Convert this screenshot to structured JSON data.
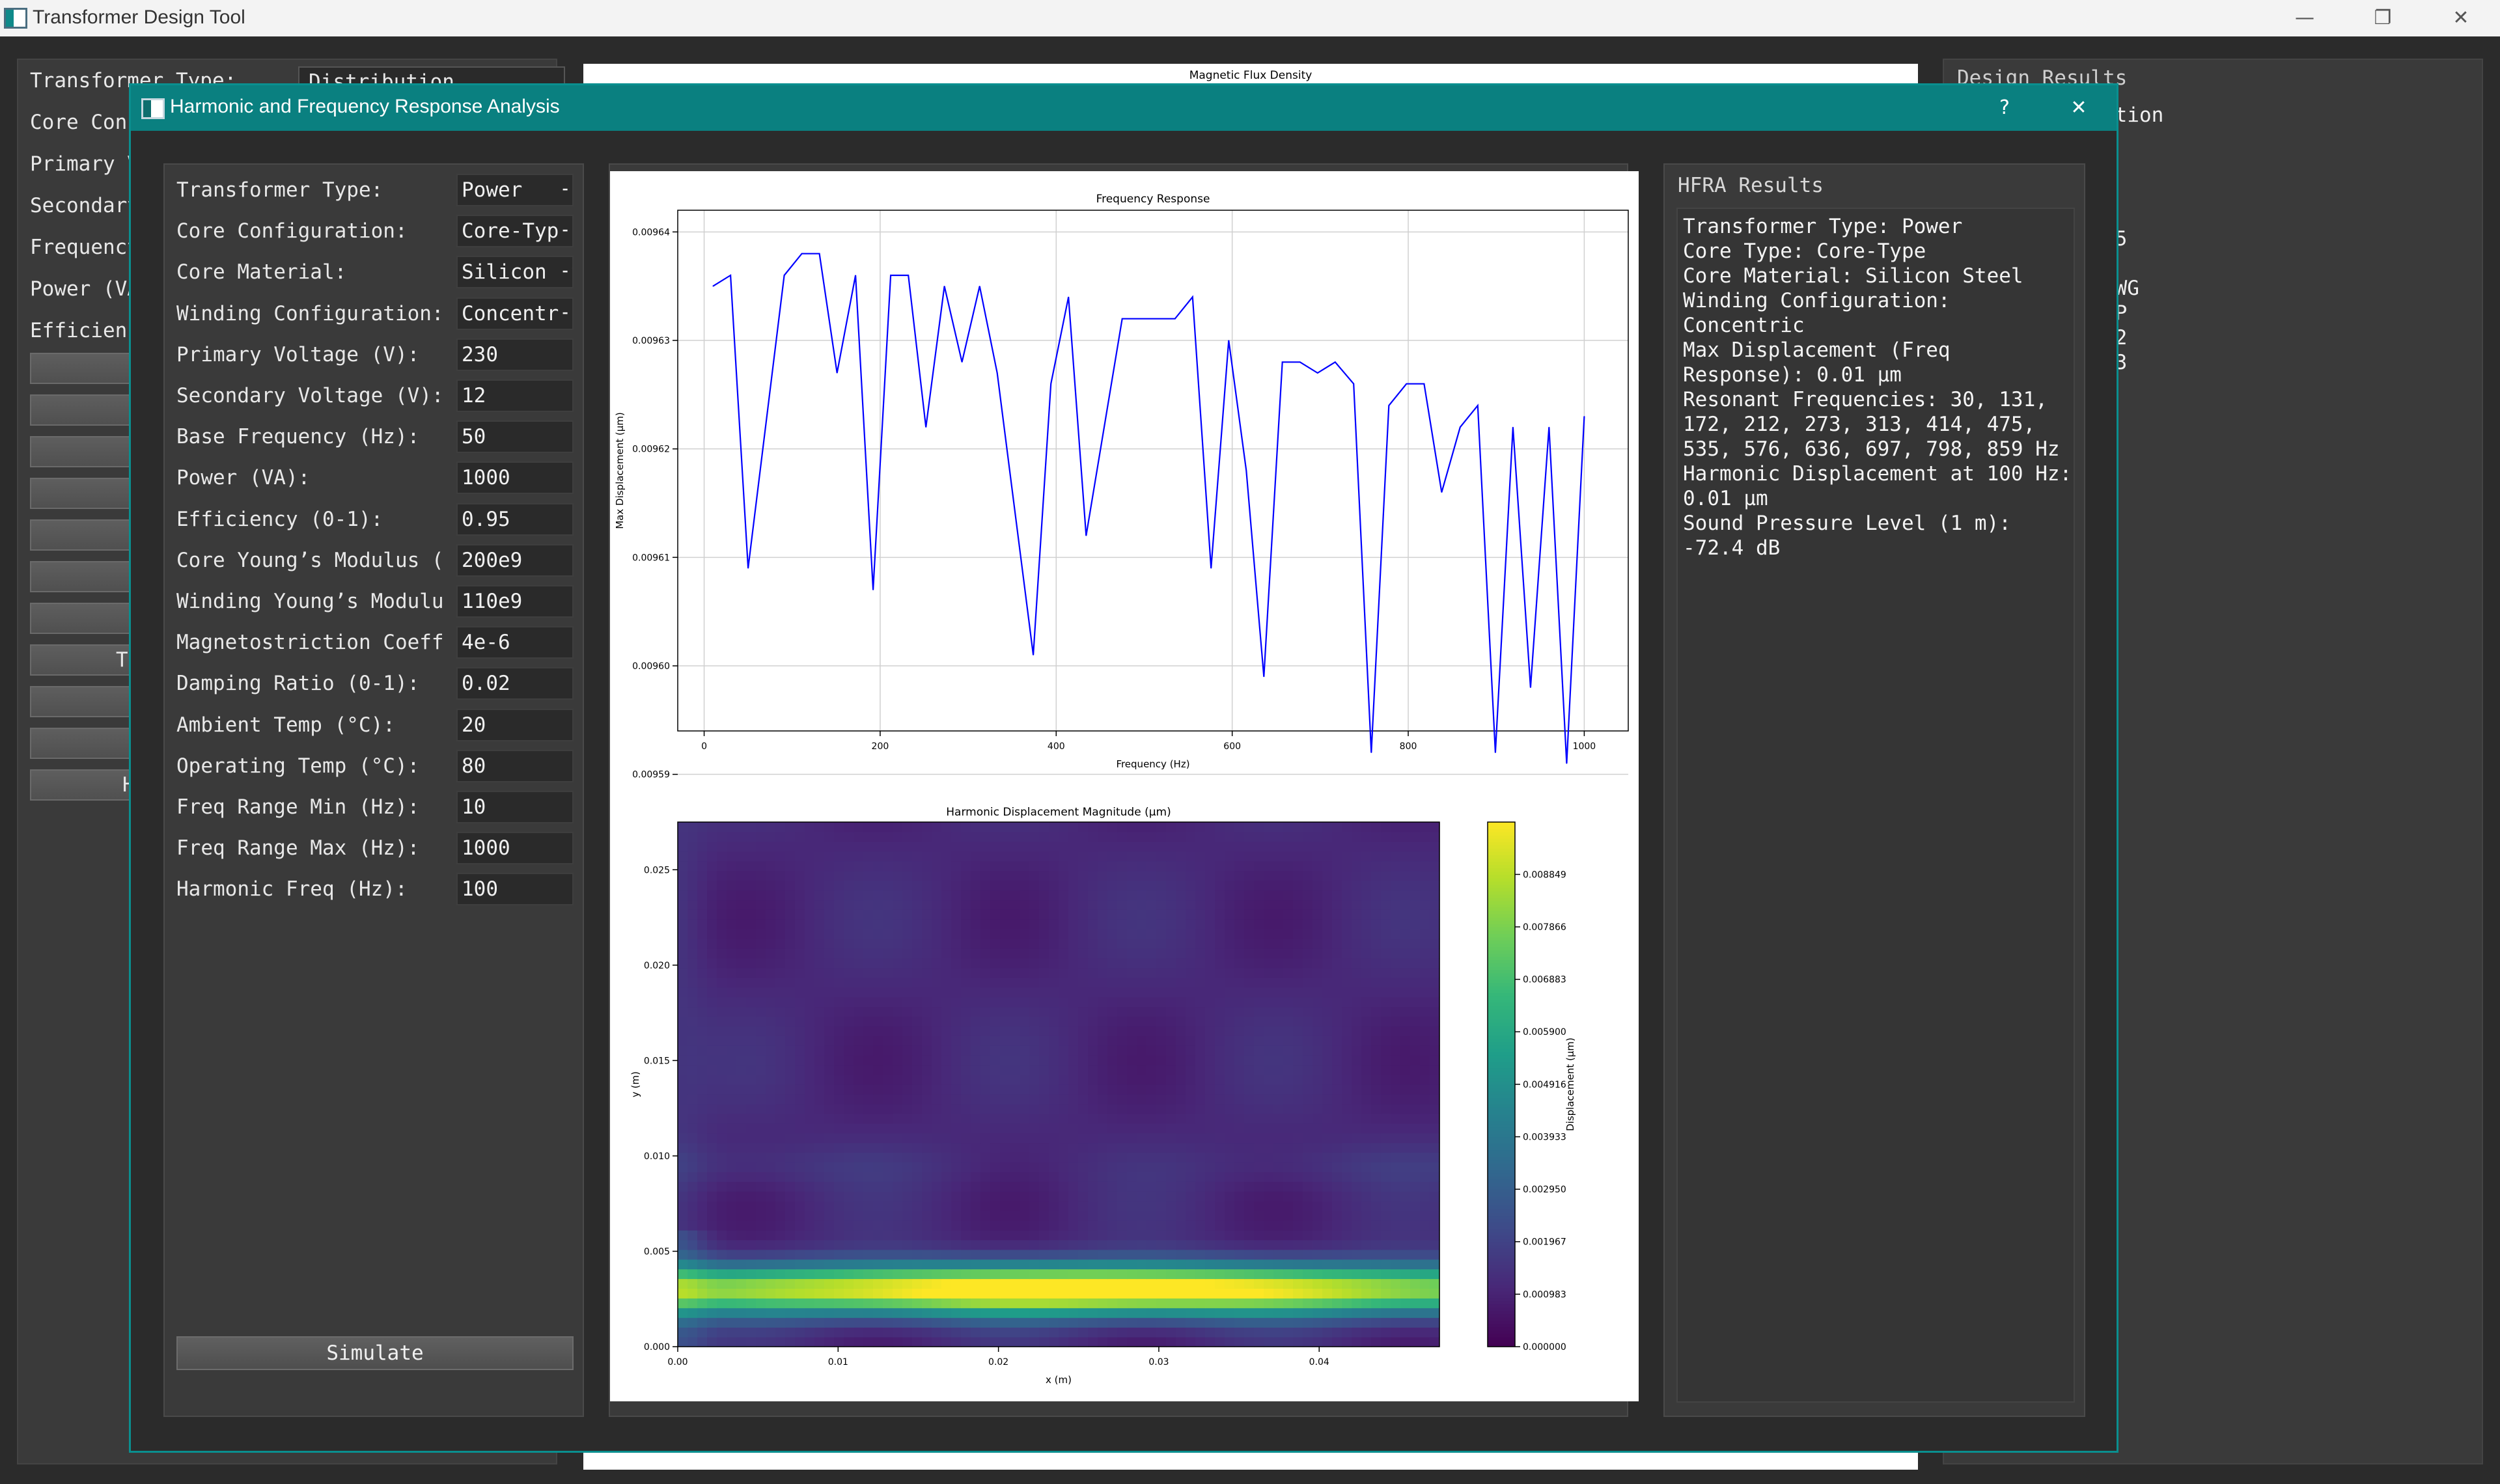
{
  "window": {
    "title": "Transformer Design Tool",
    "controls": {
      "minimize": "—",
      "maximize": "❐",
      "close": "✕"
    }
  },
  "background": {
    "left_labels": [
      "Transformer Type:",
      "Core Confi",
      "Primary V",
      "Secondary",
      "Frequency",
      "Power (VA",
      "Efficienc"
    ],
    "type_combo": "Distribution",
    "button_labels": [
      "",
      "",
      "",
      "",
      "",
      "",
      "",
      "Ter",
      "",
      "V",
      "Ha"
    ],
    "plot_title": "Magnetic Flux Density",
    "results_header": "Design Results",
    "results_text": "ype: Distribution\nell-Type\n0008 m²\n21.00\n 102774126730\nns: 4894006035\nGauge: 10 AWG\ne Gauge: 10 AWG\nPattern: P-S-P\ns: 17129021122\ners: 815667673\n)2 W\n5.00%\nsity: 1.26 T"
  },
  "dialog": {
    "title": "Harmonic and Frequency Response Analysis",
    "help_label": "?",
    "close_label": "✕",
    "form": [
      {
        "label": "Transformer Type:",
        "value": "Power",
        "kind": "combo"
      },
      {
        "label": "Core Configuration:",
        "value": "Core-Type",
        "kind": "combo"
      },
      {
        "label": "Core Material:",
        "value": "Silicon Steel",
        "kind": "combo"
      },
      {
        "label": "Winding Configuration:",
        "value": "Concentric",
        "kind": "combo"
      },
      {
        "label": "Primary Voltage (V):",
        "value": "230",
        "kind": "input"
      },
      {
        "label": "Secondary Voltage (V):",
        "value": "12",
        "kind": "input"
      },
      {
        "label": "Base Frequency (Hz):",
        "value": "50",
        "kind": "input"
      },
      {
        "label": "Power (VA):",
        "value": "1000",
        "kind": "input"
      },
      {
        "label": "Efficiency (0-1):",
        "value": "0.95",
        "kind": "input"
      },
      {
        "label": "Core Young’s Modulus (P",
        "value": "200e9",
        "kind": "input"
      },
      {
        "label": "Winding Young’s Modulus",
        "value": "110e9",
        "kind": "input"
      },
      {
        "label": "Magnetostriction Coeff:",
        "value": "4e-6",
        "kind": "input"
      },
      {
        "label": "Damping Ratio (0-1):",
        "value": "0.02",
        "kind": "input"
      },
      {
        "label": "Ambient Temp (°C):",
        "value": "20",
        "kind": "input"
      },
      {
        "label": "Operating Temp (°C):",
        "value": "80",
        "kind": "input"
      },
      {
        "label": "Freq Range Min (Hz):",
        "value": "10",
        "kind": "input"
      },
      {
        "label": "Freq Range Max (Hz):",
        "value": "1000",
        "kind": "input"
      },
      {
        "label": "Harmonic Freq (Hz):",
        "value": "100",
        "kind": "input"
      }
    ],
    "simulate_label": "Simulate",
    "results_header": "HFRA Results",
    "results_text": "Transformer Type: Power\nCore Type: Core-Type\nCore Material: Silicon Steel\nWinding Configuration:\nConcentric\nMax Displacement (Freq\nResponse): 0.01 µm\nResonant Frequencies: 30, 131,\n172, 212, 273, 313, 414, 475,\n535, 576, 636, 697, 798, 859 Hz\nHarmonic Displacement at 100 Hz:\n0.01 µm\nSound Pressure Level (1 m):\n-72.4 dB"
  },
  "colors": {
    "accent": "#0a8080",
    "line": "#0000ff"
  },
  "chart_data": [
    {
      "type": "line",
      "title": "Frequency Response",
      "xlabel": "Frequency (Hz)",
      "ylabel": "Max Displacement (µm)",
      "xlim": [
        -30,
        1050
      ],
      "ylim": [
        0.009594,
        0.009642
      ],
      "xticks": [
        0,
        200,
        400,
        600,
        800,
        1000
      ],
      "xtick_labels": [
        "0",
        "200",
        "400",
        "600",
        "800",
        "1000"
      ],
      "yticks": [
        0.00959,
        0.0096,
        0.00961,
        0.00962,
        0.00963,
        0.00964
      ],
      "ytick_labels": [
        "0.00959",
        "0.00960",
        "0.00961",
        "0.00962",
        "0.00963",
        "0.00964"
      ],
      "grid": true,
      "series": [
        {
          "x": [
            10,
            30,
            50,
            91,
            111,
            131,
            151,
            172,
            192,
            212,
            232,
            252,
            273,
            293,
            313,
            333,
            374,
            394,
            414,
            434,
            475,
            535,
            555,
            576,
            596,
            616,
            636,
            657,
            677,
            697,
            717,
            738,
            758,
            778,
            798,
            818,
            838,
            859,
            879,
            899,
            919,
            939,
            960,
            980,
            1000
          ],
          "y": [
            0.009635,
            0.009636,
            0.009609,
            0.009636,
            0.009638,
            0.009638,
            0.009627,
            0.009636,
            0.009607,
            0.009636,
            0.009636,
            0.009622,
            0.009635,
            0.009628,
            0.009635,
            0.009627,
            0.009601,
            0.009626,
            0.009634,
            0.009612,
            0.009632,
            0.009632,
            0.009634,
            0.009609,
            0.00963,
            0.009618,
            0.009599,
            0.009628,
            0.009628,
            0.009627,
            0.009628,
            0.009626,
            0.009592,
            0.009624,
            0.009626,
            0.009626,
            0.009616,
            0.009622,
            0.009624,
            0.009592,
            0.009622,
            0.009598,
            0.009622,
            0.009591,
            0.009623
          ]
        }
      ]
    },
    {
      "type": "heatmap",
      "title": "Harmonic Displacement Magnitude (µm)",
      "xlabel": "x (m)",
      "ylabel": "y (m)",
      "colorbar_label": "Displacement (µm)",
      "xlim": [
        0,
        0.0475
      ],
      "ylim": [
        0,
        0.0275
      ],
      "xticks": [
        0,
        0.01,
        0.02,
        0.03,
        0.04
      ],
      "xtick_labels": [
        "0.00",
        "0.01",
        "0.02",
        "0.03",
        "0.04"
      ],
      "yticks": [
        0,
        0.005,
        0.01,
        0.015,
        0.02,
        0.025
      ],
      "ytick_labels": [
        "0.000",
        "0.005",
        "0.010",
        "0.015",
        "0.020",
        "0.025"
      ],
      "colorbar_ticks": [
        0.0,
        0.000983,
        0.001967,
        0.00295,
        0.003933,
        0.004916,
        0.0059,
        0.006883,
        0.007866,
        0.008849
      ],
      "colorbar_tick_labels": [
        "0.000000",
        "0.000983",
        "0.001967",
        "0.002950",
        "0.003933",
        "0.004916",
        "0.005900",
        "0.006883",
        "0.007866",
        "0.008849"
      ],
      "vmax": 0.00983,
      "peak": {
        "x": 0.025,
        "y": 0.003,
        "value": 0.0098
      }
    }
  ]
}
